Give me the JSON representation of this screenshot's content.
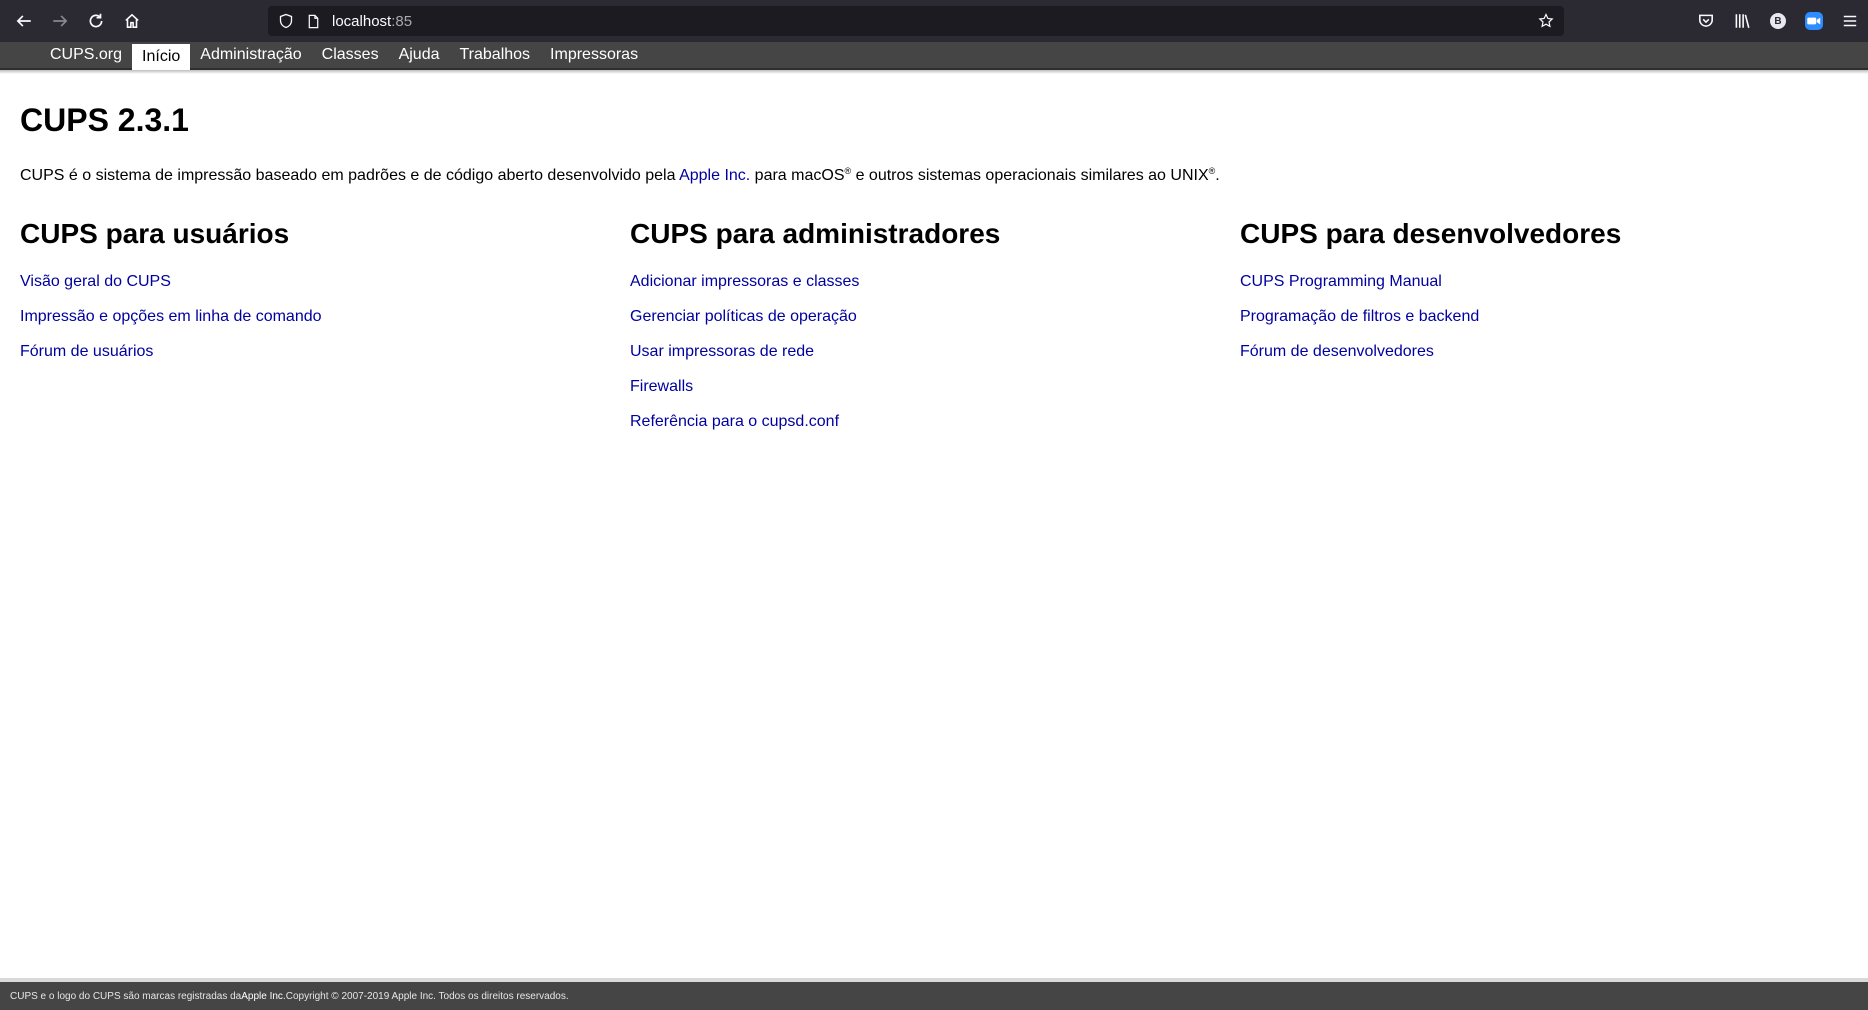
{
  "browser": {
    "url_host": "localhost",
    "url_port": ":85"
  },
  "nav": {
    "items": [
      {
        "label": "CUPS.org"
      },
      {
        "label": "Início"
      },
      {
        "label": "Administração"
      },
      {
        "label": "Classes"
      },
      {
        "label": "Ajuda"
      },
      {
        "label": "Trabalhos"
      },
      {
        "label": "Impressoras"
      }
    ],
    "active": "Início"
  },
  "main": {
    "title": "CUPS 2.3.1",
    "intro_before": "CUPS é o sistema de impressão baseado em padrões e de código aberto desenvolvido pela ",
    "intro_link": "Apple Inc.",
    "intro_middle": " para macOS",
    "intro_reg1": "®",
    "intro_after": " e outros sistemas operacionais similares ao UNIX",
    "intro_reg2": "®",
    "intro_end": "."
  },
  "columns": [
    {
      "heading": "CUPS para usuários",
      "links": [
        "Visão geral do CUPS",
        "Impressão e opções em linha de comando",
        "Fórum de usuários"
      ]
    },
    {
      "heading": "CUPS para administradores",
      "links": [
        "Adicionar impressoras e classes",
        "Gerenciar políticas de operação",
        "Usar impressoras de rede",
        "Firewalls",
        "Referência para o cupsd.conf"
      ]
    },
    {
      "heading": "CUPS para desenvolvedores",
      "links": [
        "CUPS Programming Manual",
        "Programação de filtros e backend",
        "Fórum de desenvolvedores"
      ]
    }
  ],
  "footer": {
    "before": "CUPS e o logo do CUPS são marcas registradas da ",
    "apple": "Apple Inc.",
    "after": " Copyright © 2007-2019 Apple Inc. Todos os direitos reservados."
  },
  "icons": {
    "back": "arrow-left-icon",
    "forward": "arrow-right-icon",
    "reload": "reload-icon",
    "home": "home-icon",
    "shield": "shield-icon",
    "page": "page-icon",
    "star": "star-icon",
    "pocket": "pocket-icon",
    "library": "library-icon",
    "account": "account-icon",
    "zoom_ext": "zoom-extension-icon",
    "menu": "hamburger-menu-icon"
  }
}
